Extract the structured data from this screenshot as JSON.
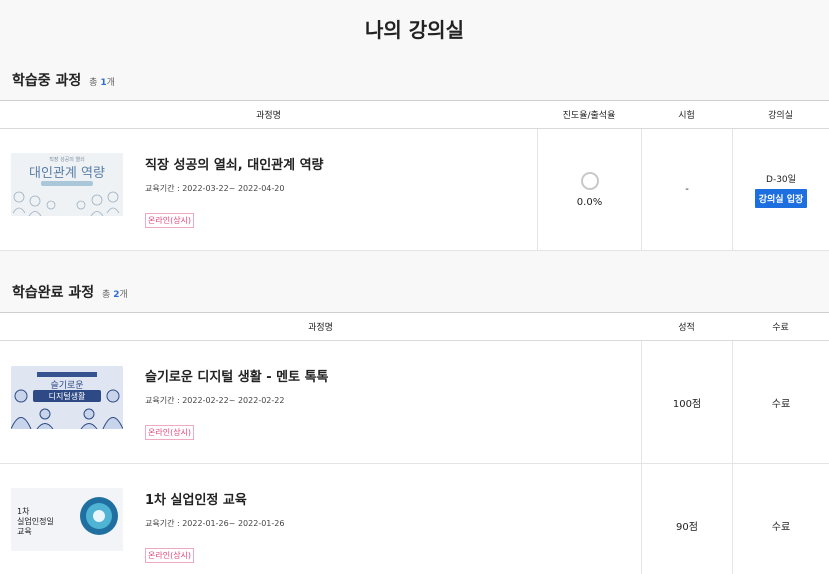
{
  "page": {
    "title": "나의 강의실"
  },
  "in_progress": {
    "heading": "학습중 과정",
    "count_prefix": "총",
    "count_num": "1",
    "count_suffix": "개",
    "columns": {
      "name": "과정명",
      "progress": "진도율/출석율",
      "exam": "시험",
      "classroom": "강의실"
    },
    "courses": [
      {
        "title": "직장 성공의 열쇠, 대인관계 역량",
        "period": "교육기간 : 2022-03-22~ 2022-04-20",
        "badge": "온라인(상시)",
        "thumb_text": "대인관계 역량",
        "progress": "0.0%",
        "exam": "-",
        "dday": "D-30일",
        "enter_label": "강의실 입장"
      }
    ]
  },
  "completed": {
    "heading": "학습완료 과정",
    "count_prefix": "총",
    "count_num": "2",
    "count_suffix": "개",
    "columns": {
      "name": "과정명",
      "score": "성적",
      "complete": "수료"
    },
    "courses": [
      {
        "title": "슬기로운 디지털 생활 - 멘토 톡톡",
        "period": "교육기간 : 2022-02-22~ 2022-02-22",
        "badge": "온라인(상시)",
        "thumb_text": "슬기로운 디지털생활",
        "score": "100점",
        "status": "수료"
      },
      {
        "title": "1차 실업인정 교육",
        "period": "교육기간 : 2022-01-26~ 2022-01-26",
        "badge": "온라인(상시)",
        "thumb_text": "1차 실업인정일 교육",
        "score": "90점",
        "status": "수료"
      }
    ]
  },
  "colors": {
    "accent": "#1d6fe0",
    "badge": "#e0457b",
    "count": "#2b6fd6"
  }
}
